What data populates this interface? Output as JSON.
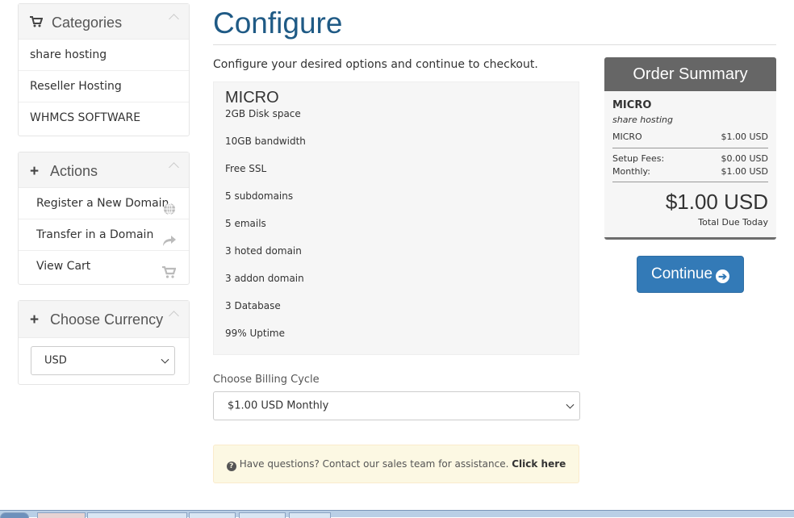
{
  "sidebar": {
    "categories": {
      "title": "Categories",
      "icon": "cart-icon",
      "items": [
        {
          "label": "share hosting"
        },
        {
          "label": "Reseller Hosting"
        },
        {
          "label": "WHMCS SOFTWARE"
        }
      ]
    },
    "actions": {
      "title": "Actions",
      "icon": "plus-icon",
      "items": [
        {
          "label": "Register a New Domain",
          "icon": "globe-icon"
        },
        {
          "label": "Transfer in a Domain",
          "icon": "share-arrow-icon"
        },
        {
          "label": "View Cart",
          "icon": "cart-icon"
        }
      ]
    },
    "currency": {
      "title": "Choose Currency",
      "icon": "plus-icon",
      "selected": "USD"
    }
  },
  "main": {
    "title": "Configure",
    "intro": "Configure your desired options and continue to checkout.",
    "product": {
      "name": "MICRO",
      "features": [
        "2GB Disk space",
        "10GB bandwidth",
        "Free SSL",
        "5 subdomains",
        "5 emails",
        "3 hoted domain",
        "3 addon domain",
        "3 Database",
        "99% Uptime"
      ]
    },
    "billing_cycle": {
      "label": "Choose Billing Cycle",
      "selected": "$1.00 USD Monthly"
    },
    "help": {
      "text": "Have questions? Contact our sales team for assistance.",
      "link": "Click here"
    }
  },
  "summary": {
    "title": "Order Summary",
    "product_name": "MICRO",
    "product_group": "share hosting",
    "line_item": {
      "label": "MICRO",
      "value": "$1.00 USD"
    },
    "setup_fees": {
      "label": "Setup Fees:",
      "value": "$0.00 USD"
    },
    "monthly": {
      "label": "Monthly:",
      "value": "$1.00 USD"
    },
    "total": "$1.00 USD",
    "total_label": "Total Due Today"
  },
  "continue_button": {
    "label": "Continue"
  },
  "colors": {
    "title_blue": "#1f5a85",
    "button_blue": "#337ab7",
    "summary_header": "#666666",
    "help_bg": "#fcf8e3"
  }
}
